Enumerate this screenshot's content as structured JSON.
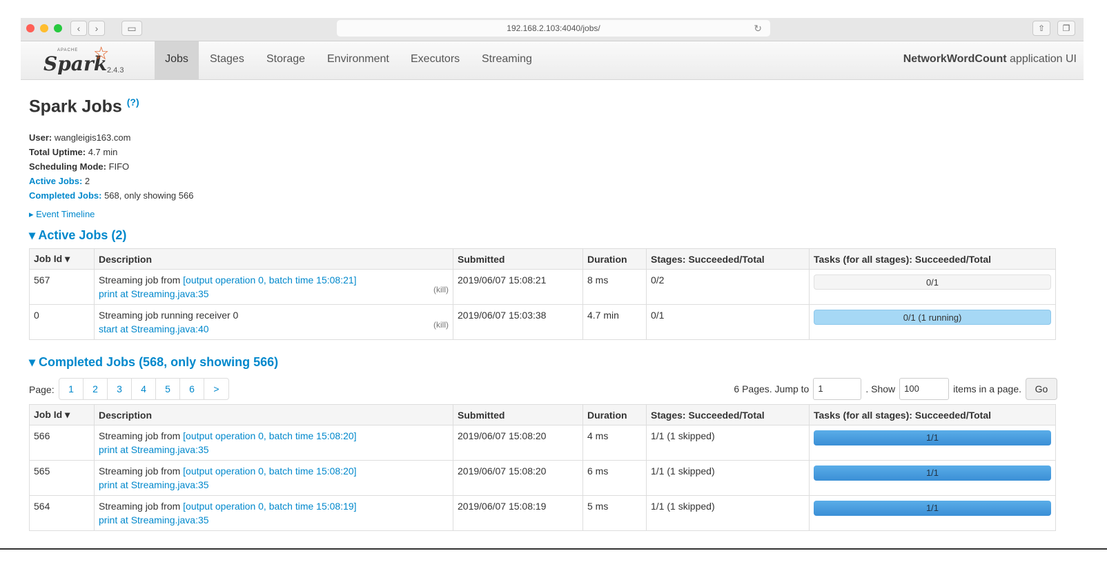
{
  "browser": {
    "url": "192.168.2.103:4040/jobs/",
    "back": "‹",
    "forward": "›"
  },
  "nav": {
    "logo_text": "Spark",
    "logo_apache": "APACHE",
    "version": "2.4.3",
    "tabs": [
      "Jobs",
      "Stages",
      "Storage",
      "Environment",
      "Executors",
      "Streaming"
    ],
    "active_tab": "Jobs",
    "app_name_bold": "NetworkWordCount",
    "app_name_rest": " application UI"
  },
  "page": {
    "title": "Spark Jobs",
    "help": "(?)"
  },
  "summary": {
    "user_label": "User:",
    "user": " wangleigis163.com",
    "uptime_label": "Total Uptime:",
    "uptime": " 4.7 min",
    "mode_label": "Scheduling Mode:",
    "mode": " FIFO",
    "active_label": "Active Jobs:",
    "active": " 2",
    "completed_label": "Completed Jobs:",
    "completed": " 568, only showing 566"
  },
  "event_timeline": "Event Timeline",
  "active_section": "Active Jobs (2)",
  "completed_section": "Completed Jobs (568, only showing 566)",
  "columns": [
    "Job Id ▾",
    "Description",
    "Submitted",
    "Duration",
    "Stages: Succeeded/Total",
    "Tasks (for all stages): Succeeded/Total"
  ],
  "active_jobs": [
    {
      "id": "567",
      "desc_pre": "Streaming job from ",
      "desc_link": "[output operation 0, batch time 15:08:21]",
      "sub": "print at Streaming.java:35",
      "kill": "(kill)",
      "submitted": "2019/06/07 15:08:21",
      "duration": "8 ms",
      "stages": "0/2",
      "tasks": "0/1",
      "task_fraction": 0
    },
    {
      "id": "0",
      "desc_pre": "Streaming job running receiver 0",
      "desc_link": "",
      "sub": "start at Streaming.java:40",
      "kill": "(kill)",
      "submitted": "2019/06/07 15:03:38",
      "duration": "4.7 min",
      "stages": "0/1",
      "tasks": "0/1 (1 running)",
      "task_fraction": 0
    }
  ],
  "pager": {
    "label": "Page:",
    "pages": [
      "1",
      "2",
      "3",
      "4",
      "5",
      "6",
      ">"
    ],
    "jump_text": "6 Pages. Jump to",
    "jump_value": "1",
    "show_text": ". Show",
    "show_value": "100",
    "items_text": "items in a page.",
    "go": "Go"
  },
  "completed_jobs": [
    {
      "id": "566",
      "desc_pre": "Streaming job from ",
      "desc_link": "[output operation 0, batch time 15:08:20]",
      "sub": "print at Streaming.java:35",
      "submitted": "2019/06/07 15:08:20",
      "duration": "4 ms",
      "stages": "1/1 (1 skipped)",
      "tasks": "1/1",
      "task_fraction": 1
    },
    {
      "id": "565",
      "desc_pre": "Streaming job from ",
      "desc_link": "[output operation 0, batch time 15:08:20]",
      "sub": "print at Streaming.java:35",
      "submitted": "2019/06/07 15:08:20",
      "duration": "6 ms",
      "stages": "1/1 (1 skipped)",
      "tasks": "1/1",
      "task_fraction": 1
    },
    {
      "id": "564",
      "desc_pre": "Streaming job from ",
      "desc_link": "[output operation 0, batch time 15:08:19]",
      "sub": "print at Streaming.java:35",
      "submitted": "2019/06/07 15:08:19",
      "duration": "5 ms",
      "stages": "1/1 (1 skipped)",
      "tasks": "1/1",
      "task_fraction": 1
    }
  ]
}
